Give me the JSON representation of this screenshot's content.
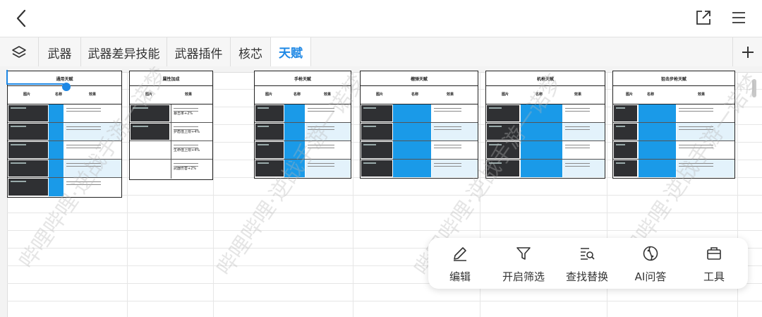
{
  "tabs": {
    "items": [
      {
        "label": "武器"
      },
      {
        "label": "武器差异技能"
      },
      {
        "label": "武器插件"
      },
      {
        "label": "核芯"
      },
      {
        "label": "天赋"
      }
    ],
    "active_index": 4
  },
  "sheet": {
    "blocks": [
      {
        "title": "通用天赋",
        "headers": [
          "图片",
          "名称",
          "效果"
        ]
      },
      {
        "title": "属性加成",
        "headers": [
          "图片",
          "效果"
        ]
      },
      {
        "title": "手枪天赋",
        "headers": [
          "图片",
          "名称",
          "效果"
        ]
      },
      {
        "title": "榴弹天赋",
        "headers": [
          "图片",
          "名称",
          "效果"
        ]
      },
      {
        "title": "机枪天赋",
        "headers": [
          "图片",
          "名称",
          "效果"
        ]
      },
      {
        "title": "狙击步枪天赋",
        "headers": [
          "图片",
          "名称",
          "效果"
        ]
      }
    ],
    "attr_effects": [
      "暴击率+2%",
      "护盾值上限+4%",
      "生命值上限+4%",
      "武器伤害+2%"
    ]
  },
  "watermark": {
    "text": "哔哩哔哩·逆战手游一诺梦"
  },
  "toolbar": {
    "items": [
      {
        "label": "编辑",
        "icon": "pencil-icon"
      },
      {
        "label": "开启筛选",
        "icon": "filter-icon"
      },
      {
        "label": "查找替换",
        "icon": "find-replace-icon"
      },
      {
        "label": "AI问答",
        "icon": "ai-icon"
      },
      {
        "label": "工具",
        "icon": "toolbox-icon"
      }
    ]
  },
  "colors": {
    "accent": "#1e88e5",
    "name_cell": "#1a9ae8",
    "alt_row": "#e3f2fb"
  }
}
